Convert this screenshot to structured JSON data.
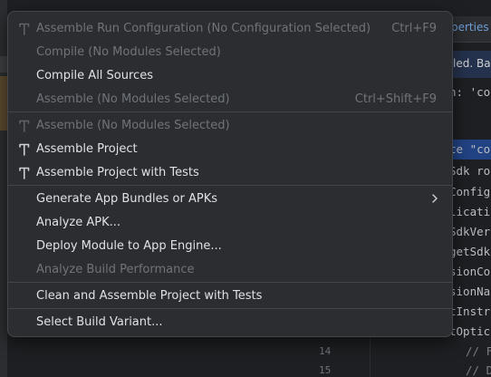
{
  "background": {
    "tab_fragment": "perties",
    "banner_fragment": "led. Ba",
    "code_lines": [
      "n: 'co",
      "ce \"co",
      "Sdk ro",
      "Config",
      "licati",
      "SdkVer",
      "getSdk",
      "sionCo",
      "sionNa",
      "tInstr",
      "tOptic",
      "// F",
      "// D"
    ],
    "gutter_numbers": [
      "14",
      "15"
    ]
  },
  "menu": {
    "items": [
      {
        "label": "Assemble Run Configuration (No Configuration Selected)",
        "shortcut": "Ctrl+F9",
        "disabled": true,
        "icon": "hammer-icon"
      },
      {
        "label": "Compile (No Modules Selected)",
        "disabled": true
      },
      {
        "label": "Compile All Sources",
        "disabled": false
      },
      {
        "label": "Assemble (No Modules Selected)",
        "shortcut": "Ctrl+Shift+F9",
        "disabled": true
      },
      {
        "label": "Assemble (No Modules Selected)",
        "disabled": true,
        "icon": "hammer-icon"
      },
      {
        "label": "Assemble Project",
        "disabled": false,
        "icon": "hammer-icon"
      },
      {
        "label": "Assemble Project with Tests",
        "disabled": false,
        "icon": "hammer-icon"
      },
      {
        "label": "Generate App Bundles or APKs",
        "disabled": false,
        "submenu": true
      },
      {
        "label": "Analyze APK...",
        "disabled": false
      },
      {
        "label": "Deploy Module to App Engine...",
        "disabled": false
      },
      {
        "label": "Analyze Build Performance",
        "disabled": true
      },
      {
        "label": "Clean and Assemble Project with Tests",
        "disabled": false
      },
      {
        "label": "Select Build Variant...",
        "disabled": false
      }
    ]
  },
  "colors": {
    "menu_bg": "#2b2d30",
    "text": "#dfe1e5",
    "disabled_text": "#6f737a",
    "separator": "#43454a",
    "selection_highlight": "#214283"
  }
}
